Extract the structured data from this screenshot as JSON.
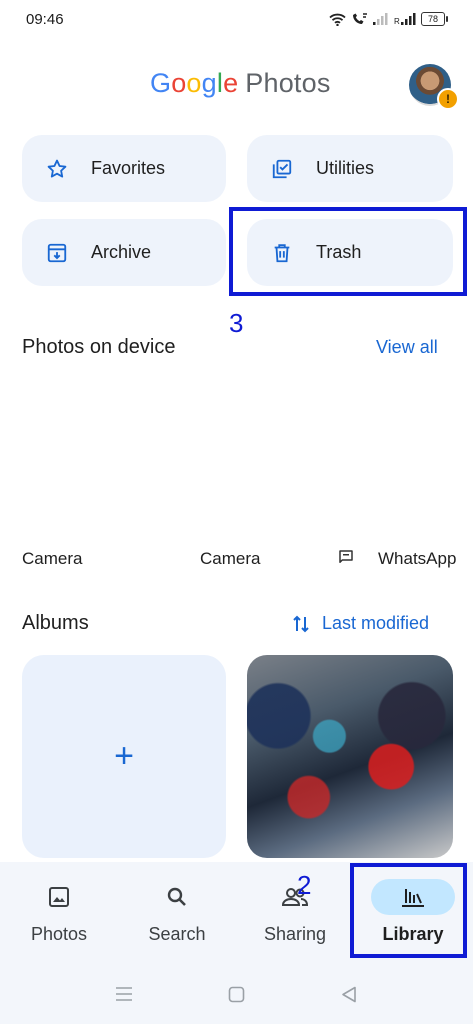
{
  "status_bar": {
    "time": "09:46",
    "battery": "78"
  },
  "header": {
    "logo_letters": [
      "G",
      "o",
      "o",
      "g",
      "l",
      "e"
    ],
    "logo_suffix": "Photos",
    "avatar_badge": "!"
  },
  "quick_cards": {
    "favorites": "Favorites",
    "utilities": "Utilities",
    "archive": "Archive",
    "trash": "Trash"
  },
  "annotations": {
    "trash_marker": "3",
    "library_marker": "2",
    "highlight_color": "#0f1bd4"
  },
  "photos_on_device": {
    "title": "Photos on device",
    "view_all": "View all",
    "folders": [
      "Camera",
      "Camera",
      "WhatsApp"
    ]
  },
  "albums": {
    "title": "Albums",
    "sort_label": "Last modified",
    "new_album_symbol": "+"
  },
  "bottom_nav": {
    "photos": "Photos",
    "search": "Search",
    "sharing": "Sharing",
    "library": "Library"
  },
  "colors": {
    "accent": "#1967d2",
    "card_bg": "#eef3fb",
    "nav_active": "#c2e7ff"
  }
}
